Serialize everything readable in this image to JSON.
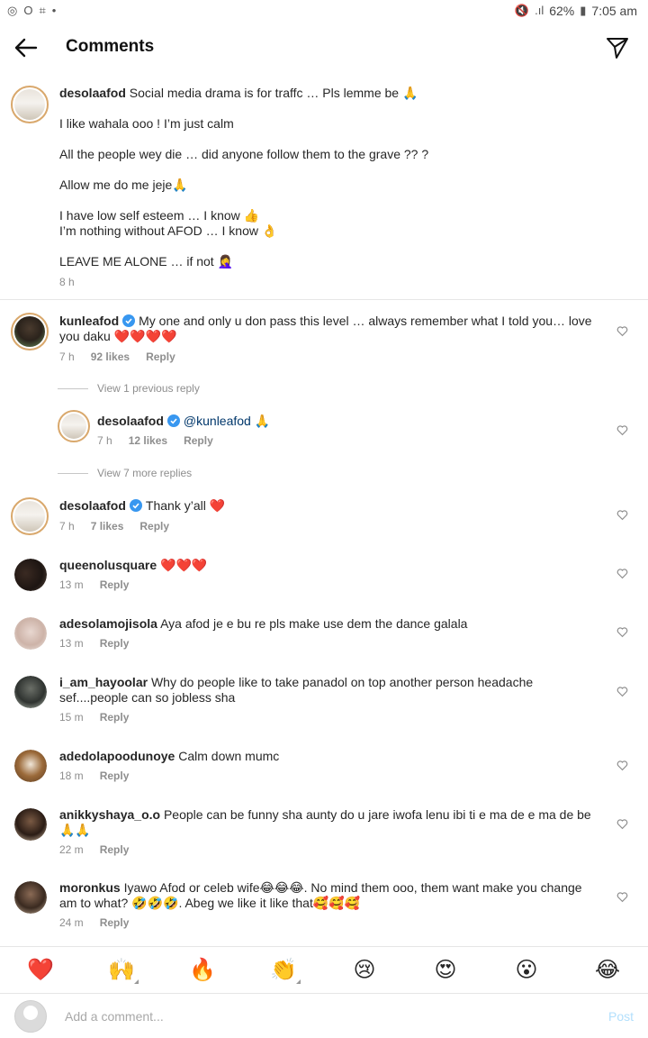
{
  "status_bar": {
    "battery": "62%",
    "time": "7:05 am"
  },
  "header": {
    "title": "Comments"
  },
  "caption": {
    "username": "desolaafod",
    "lines": [
      "Social media drama is for traffc … Pls lemme be 🙏",
      "",
      "I like wahala ooo ! I’m just calm",
      "",
      "All the people wey die … did anyone follow them to the grave ?? ?",
      "",
      "Allow me do me jeje🙏",
      "",
      "I have low self esteem … I know 👍",
      "I’m nothing without AFOD … I know 👌",
      "",
      "LEAVE ME ALONE … if not 🤦‍♀️"
    ],
    "time": "8 h"
  },
  "comments": [
    {
      "username": "kunleafod",
      "verified": true,
      "text_line1": "My one and only u don pass this level … always remember what I told you… love",
      "text_line2": "you daku ❤️❤️❤️❤️",
      "time": "7 h",
      "likes": "92 likes",
      "reply": "Reply"
    },
    {
      "username": "desolaafod",
      "verified": true,
      "mention": "@kunleafod",
      "text": " 🙏",
      "time": "7 h",
      "likes": "12 likes",
      "reply": "Reply"
    },
    {
      "username": "desolaafod",
      "verified": true,
      "text": "Thank y’all ❤️",
      "time": "7 h",
      "likes": "7 likes",
      "reply": "Reply"
    },
    {
      "username": "queenolusquare",
      "text": "❤️❤️❤️",
      "time": "13 m",
      "reply": "Reply"
    },
    {
      "username": "adesolamojisola",
      "text": "Aya afod je e bu re  pls  make use dem the dance galala",
      "time": "13 m",
      "reply": "Reply"
    },
    {
      "username": "i_am_hayoolar",
      "text_line1": "Why do people like to take panadol on top another person headache",
      "text_line2": "sef....people can so jobless sha",
      "time": "15 m",
      "reply": "Reply"
    },
    {
      "username": "adedolapoodunoye",
      "text": "Calm down mumc",
      "time": "18 m",
      "reply": "Reply"
    },
    {
      "username": "anikkyshaya_o.o",
      "text_line1": "People can be funny sha aunty do u jare iwofa lenu ibi ti e ma de e ma de be",
      "text_line2": "🙏🙏",
      "time": "22 m",
      "reply": "Reply"
    },
    {
      "username": "moronkus",
      "text_line1": "Iyawo Afod or celeb wife😂😂😂. No mind them ooo, them want make you change",
      "text_line2": "am to what? 🤣🤣🤣. Abeg we like it like that🥰🥰🥰",
      "time": "24 m",
      "reply": "Reply"
    }
  ],
  "view_replies": {
    "previous": "View 1 previous reply",
    "more": "View 7 more replies"
  },
  "emoji_bar": [
    "❤️",
    "🙌",
    "🔥",
    "👏",
    "😢",
    "😍",
    "😮",
    "😂"
  ],
  "composer": {
    "placeholder": "Add a comment...",
    "post_label": "Post"
  },
  "colors": {
    "link": "#00376b",
    "muted": "#8e8e8e",
    "post_disabled": "#b2dffc",
    "verified": "#3897f0"
  }
}
